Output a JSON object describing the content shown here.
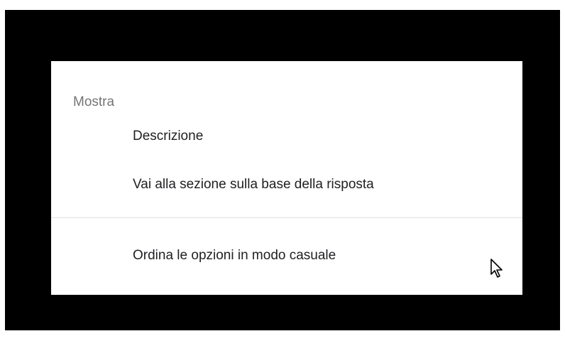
{
  "menu": {
    "header": "Mostra",
    "items": [
      {
        "label": "Descrizione"
      },
      {
        "label": "Vai alla sezione sulla base della risposta"
      },
      {
        "label": "Ordina le opzioni in modo casuale"
      }
    ]
  },
  "cursor": {
    "icon": "arrow-pointer-icon"
  },
  "colors": {
    "background": "#000000",
    "menu_bg": "#ffffff",
    "header_text": "#757575",
    "item_text": "#202124",
    "divider": "#e0e0e0"
  }
}
